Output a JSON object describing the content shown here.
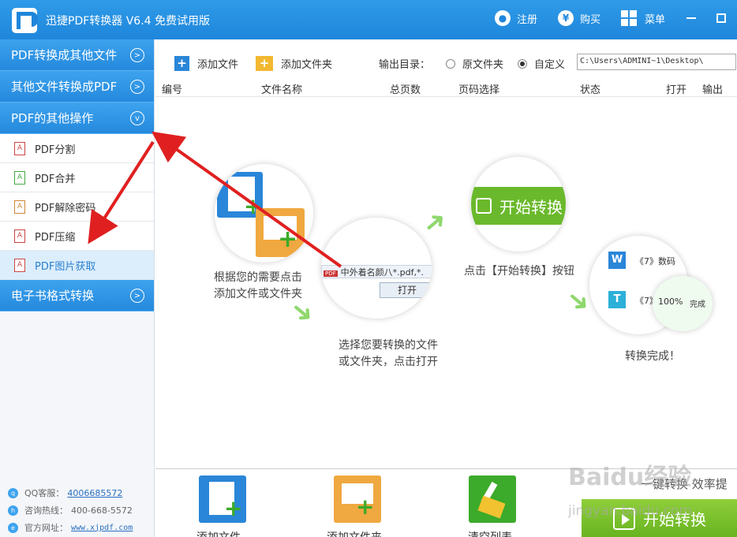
{
  "app": {
    "title": "迅捷PDF转换器 V6.4 免费试用版",
    "login": "注册",
    "buy": "购买",
    "menu": "菜单"
  },
  "sidebar": {
    "categories": [
      {
        "label": "PDF转换成其他文件"
      },
      {
        "label": "其他文件转换成PDF"
      },
      {
        "label": "PDF的其他操作"
      },
      {
        "label": "电子书格式转换"
      }
    ],
    "items": [
      {
        "label": "PDF分割"
      },
      {
        "label": "PDF合并"
      },
      {
        "label": "PDF解除密码"
      },
      {
        "label": "PDF压缩"
      },
      {
        "label": "PDF图片获取"
      }
    ],
    "contact": {
      "qq_label": "QQ客服：",
      "qq": "4006685572",
      "hotline_label": "咨询热线：",
      "hotline": "400-668-5572",
      "site_label": "官方网址：",
      "site": "www.xjpdf.com"
    }
  },
  "toolbar": {
    "add_file": "添加文件",
    "add_folder": "添加文件夹",
    "output_label": "输出目录：",
    "radio_original": "原文件夹",
    "radio_custom": "自定义",
    "path": "C:\\Users\\ADMINI~1\\Desktop\\"
  },
  "table": {
    "headers": [
      "编号",
      "文件名称",
      "总页数",
      "页码选择",
      "状态",
      "打开",
      "输出"
    ]
  },
  "guide": {
    "step1": "根据您的需要点击\n添加文件或文件夹",
    "step2": "选择您要转换的文件\n或文件夹，点击打开",
    "step3": "点击【开始转换】按钮",
    "step4": "转换完成！",
    "dialog_file": "中外着名颜八*.pdf,*.",
    "dialog_open": "打开",
    "start_label": "开始转换",
    "file_w": "《7》数码",
    "file_t": "《7》",
    "progress": "100%",
    "done": "完成"
  },
  "bottom": {
    "add_file": "添加文件",
    "add_folder": "添加文件夹",
    "clear": "清空列表",
    "slogan": "一键转换 效率提",
    "start": "开始转换"
  },
  "watermark": {
    "main": "Baidu经验",
    "sub": "jingyan.baidu.com"
  },
  "colors": {
    "accent": "#2589dd",
    "start": "#67b320",
    "annotation": "#e02020"
  }
}
